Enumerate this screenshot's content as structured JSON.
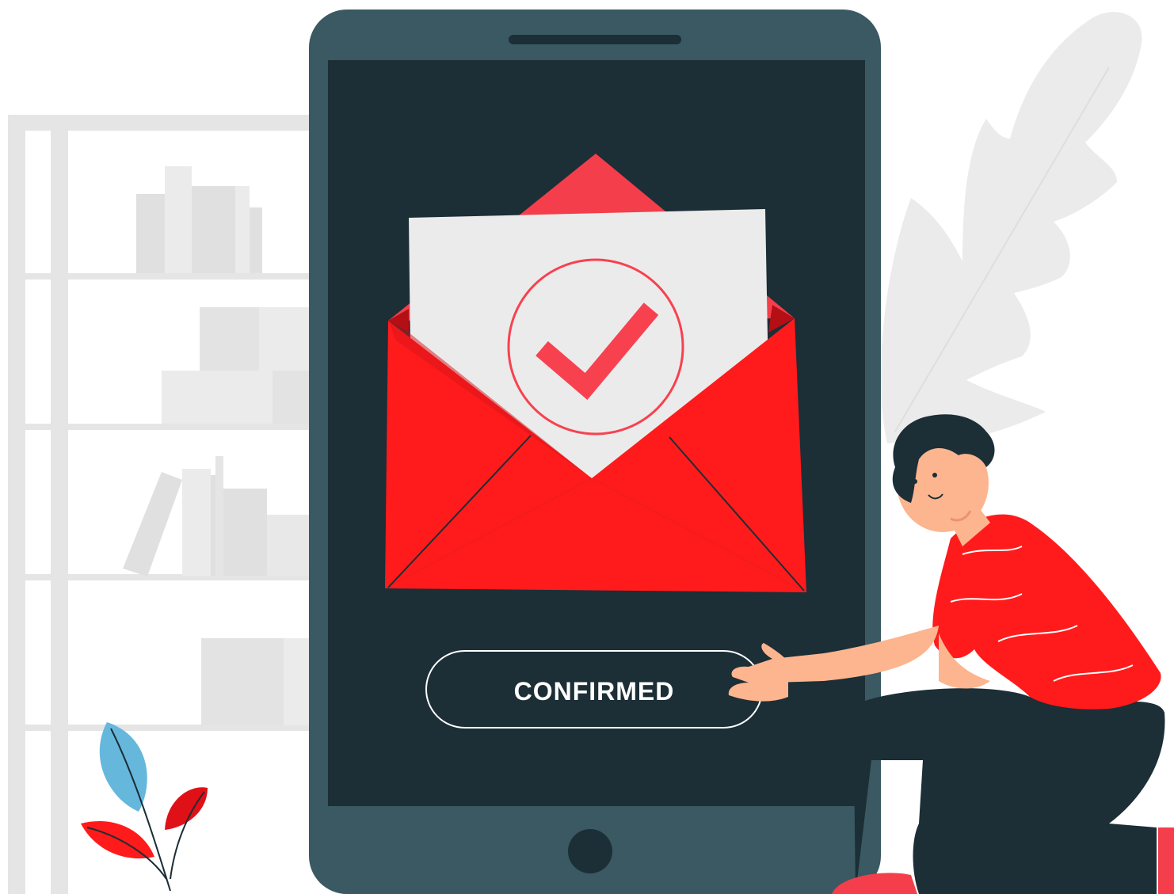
{
  "confirm_button": {
    "label": "CONFIRMED"
  },
  "colors": {
    "tablet_frame": "#3a5962",
    "tablet_screen": "#1c2e36",
    "envelope_red": "#ff1b1b",
    "envelope_flap": "#f43e4b",
    "letter_paper": "#ebebeb",
    "check_mark": "#f8414f",
    "shelf_gray": "#e5e5e5",
    "leaf_gray": "#ebebeb",
    "plant_blue": "#66b7dc",
    "skin": "#fcb58e",
    "pants": "#1c2e36",
    "button_text": "#ffffff"
  },
  "icons": {
    "check": "check-circle-icon",
    "envelope": "envelope-icon",
    "home": "home-button-icon"
  }
}
